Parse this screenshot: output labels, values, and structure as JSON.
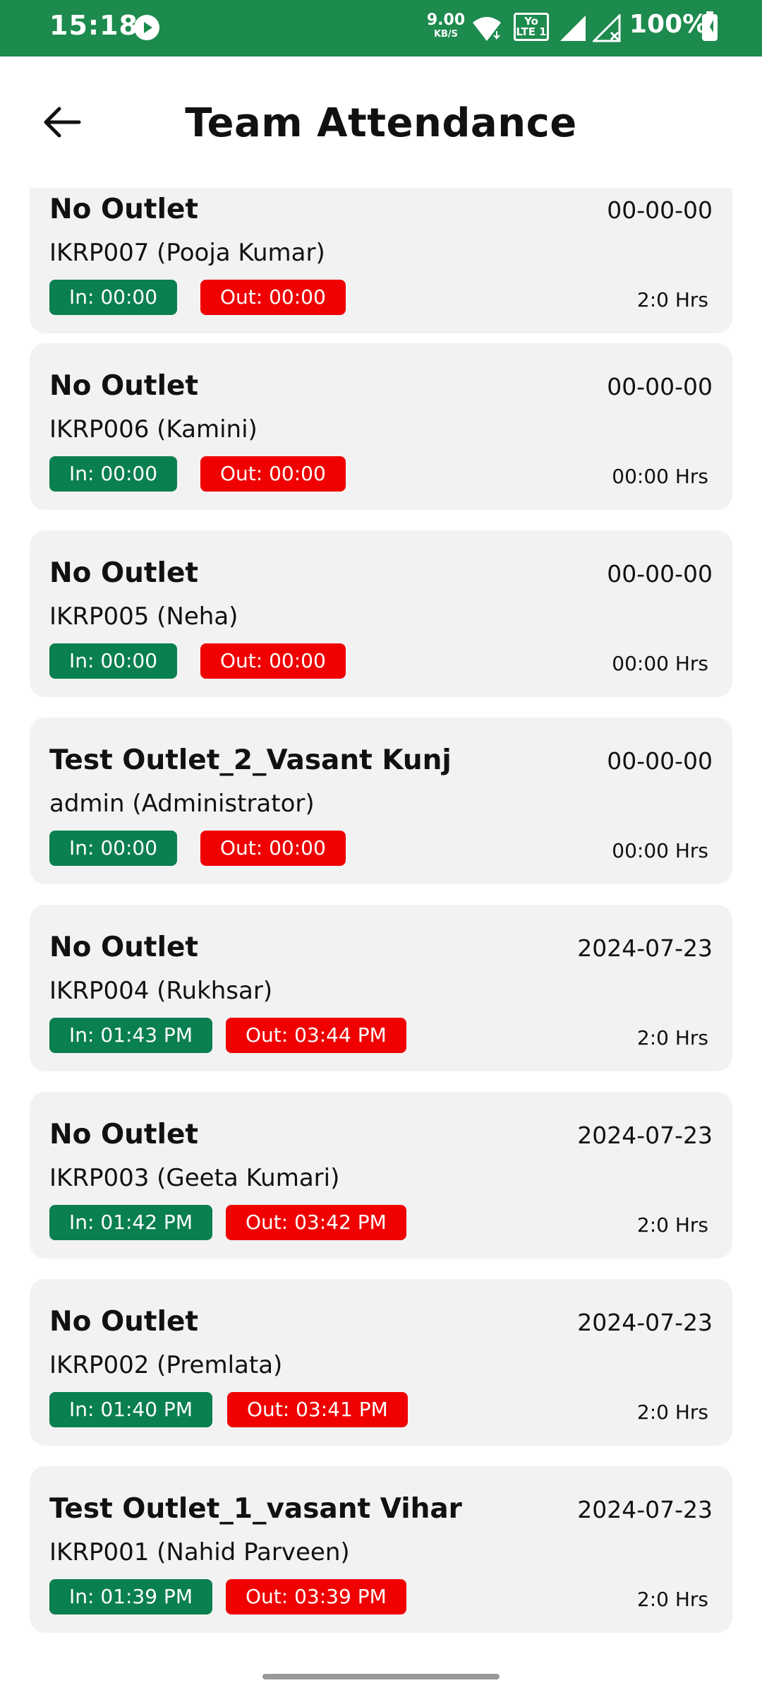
{
  "status_bar": {
    "time": "15:18",
    "net_speed_value": "9.00",
    "net_speed_unit": "KB/S",
    "volte_label": "Yo LTE 1",
    "battery": "100%"
  },
  "header": {
    "title": "Team Attendance",
    "back_icon": "arrow-left-icon"
  },
  "records": [
    {
      "outlet": "No Outlet",
      "date": "00-00-00",
      "employee": "IKRP007 (Pooja Kumar)",
      "in": "In: 00:00",
      "out": "Out: 00:00",
      "hours": "2:0 Hrs"
    },
    {
      "outlet": "No Outlet",
      "date": "00-00-00",
      "employee": "IKRP006 (Kamini)",
      "in": "In: 00:00",
      "out": "Out: 00:00",
      "hours": "00:00 Hrs"
    },
    {
      "outlet": "No Outlet",
      "date": "00-00-00",
      "employee": "IKRP005 (Neha)",
      "in": "In: 00:00",
      "out": "Out: 00:00",
      "hours": "00:00 Hrs"
    },
    {
      "outlet": "Test Outlet_2_Vasant Kunj",
      "date": "00-00-00",
      "employee": "admin (Administrator)",
      "in": "In: 00:00",
      "out": "Out: 00:00",
      "hours": "00:00 Hrs"
    },
    {
      "outlet": "No Outlet",
      "date": "2024-07-23",
      "employee": "IKRP004 (Rukhsar)",
      "in": "In: 01:43 PM",
      "out": "Out: 03:44 PM",
      "hours": "2:0 Hrs"
    },
    {
      "outlet": "No Outlet",
      "date": "2024-07-23",
      "employee": "IKRP003 (Geeta Kumari)",
      "in": "In: 01:42 PM",
      "out": "Out: 03:42 PM",
      "hours": "2:0 Hrs"
    },
    {
      "outlet": "No Outlet",
      "date": "2024-07-23",
      "employee": "IKRP002 (Premlata)",
      "in": "In: 01:40 PM",
      "out": "Out: 03:41 PM",
      "hours": "2:0 Hrs"
    },
    {
      "outlet": "Test Outlet_1_vasant Vihar",
      "date": "2024-07-23",
      "employee": "IKRP001 (Nahid Parveen)",
      "in": "In: 01:39 PM",
      "out": "Out: 03:39 PM",
      "hours": "2:0 Hrs"
    }
  ],
  "colors": {
    "brand_green": "#1d8a4e",
    "in_badge": "#0a7f4f",
    "out_badge": "#f00000",
    "card_bg": "#f2f2f2"
  }
}
